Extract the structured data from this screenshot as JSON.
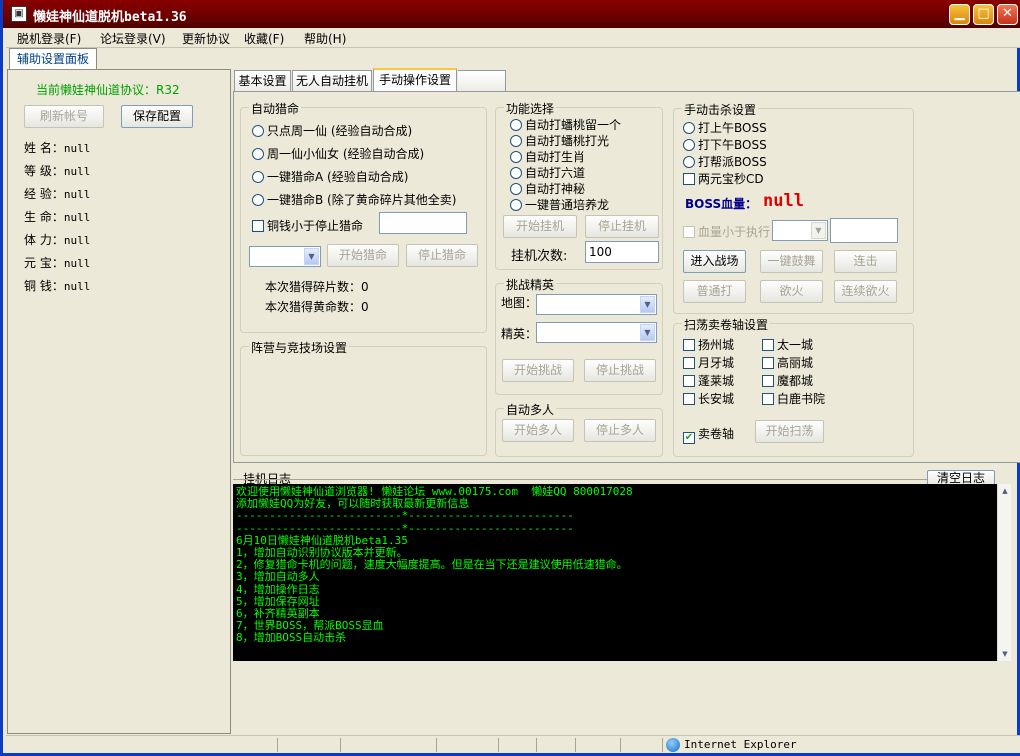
{
  "window": {
    "title": "懒娃神仙道脱机beta1.36",
    "colors": {
      "titlebar": "#8a0000",
      "log_bg": "#000000",
      "log_fg": "#00ff00",
      "boss_hp": "#e00000",
      "protocol": "#00a000"
    }
  },
  "menu": [
    "脱机登录(F)",
    "论坛登录(V)",
    "更新协议",
    "收藏(F)",
    "帮助(H)"
  ],
  "left": {
    "tab": "辅助设置面板",
    "protocol": "当前懒娃神仙道协议：R32",
    "refresh_button": "刷新帐号",
    "save_button": "保存配置",
    "stats": [
      {
        "label": "姓 名：",
        "value": "null"
      },
      {
        "label": "等 级：",
        "value": "null"
      },
      {
        "label": "经 验：",
        "value": "null"
      },
      {
        "label": "生 命：",
        "value": "null"
      },
      {
        "label": "体 力：",
        "value": "null"
      },
      {
        "label": "元 宝：",
        "value": "null"
      },
      {
        "label": "铜 钱：",
        "value": "null"
      }
    ]
  },
  "tabs": [
    "基本设置",
    "无人自动挂机",
    "手动操作设置"
  ],
  "auto_fate": {
    "title": "自动猎命",
    "options": [
      "只点周一仙 (经验自动合成)",
      "周一仙小仙女 (经验自动合成)",
      "一键猎命A (经验自动合成)",
      "一键猎命B (除了黄命碎片其他全卖)"
    ],
    "stop_check": "铜钱小于停止猎命",
    "start": "开始猎命",
    "stop": "停止猎命",
    "fragments": "本次猎得碎片数：0",
    "yellow": "本次猎得黄命数：0"
  },
  "camp": {
    "title": "阵营与竞技场设置"
  },
  "functions": {
    "title": "功能选择",
    "options": [
      "自动打蟠桃留一个",
      "自动打蟠桃打光",
      "自动打生肖",
      "自动打六道",
      "自动打神秘",
      "一键普通培养龙"
    ],
    "start": "开始挂机",
    "stop": "停止挂机",
    "count_label": "挂机次数:",
    "count_value": "100"
  },
  "elite": {
    "title": "挑战精英",
    "map_label": "地图：",
    "elite_label": "精英：",
    "start": "开始挑战",
    "stop": "停止挑战"
  },
  "multi": {
    "title": "自动多人",
    "start": "开始多人",
    "stop": "停止多人"
  },
  "manual_kill": {
    "title": "手动击杀设置",
    "options": [
      "打上午BOSS",
      "打下午BOSS",
      "打帮派BOSS"
    ],
    "cd_check": "两元宝秒CD",
    "hp_label": "BOSS血量：",
    "hp_value": "null",
    "exec_check": "血量小于执行",
    "buttons": [
      "进入战场",
      "一键鼓舞",
      "连击",
      "普通打",
      "欲火",
      "连续欲火"
    ]
  },
  "sweep": {
    "title": "扫荡卖卷轴设置",
    "cities": [
      "扬州城",
      "太一城",
      "月牙城",
      "高丽城",
      "蓬莱城",
      "魔都城",
      "长安城",
      "白鹿书院"
    ],
    "sell_check": "卖卷轴",
    "start": "开始扫荡"
  },
  "log": {
    "title": "挂机日志",
    "clear": "清空日志",
    "lines": [
      "欢迎使用懒娃神仙道浏览器! 懒娃论坛 www.00175.com  懒娃QQ 800017028",
      "添加懒娃QQ为好友，可以随时获取最新更新信息",
      "-------------------------*-------------------------",
      "-------------------------*-------------------------",
      "6月10日懒娃神仙道脱机beta1.35",
      "1，增加自动识别协议版本并更新。",
      "2，修复猎命卡机的问题，速度大幅度提高。但是在当下还是建议使用低速猎命。",
      "3，增加自动多人",
      "4，增加操作日志",
      "5，增加保存网址",
      "6，补齐精英副本",
      "7，世界BOSS，帮派BOSS显血",
      "8，增加BOSS自动击杀"
    ]
  },
  "status": {
    "zone": "Internet Explorer"
  }
}
